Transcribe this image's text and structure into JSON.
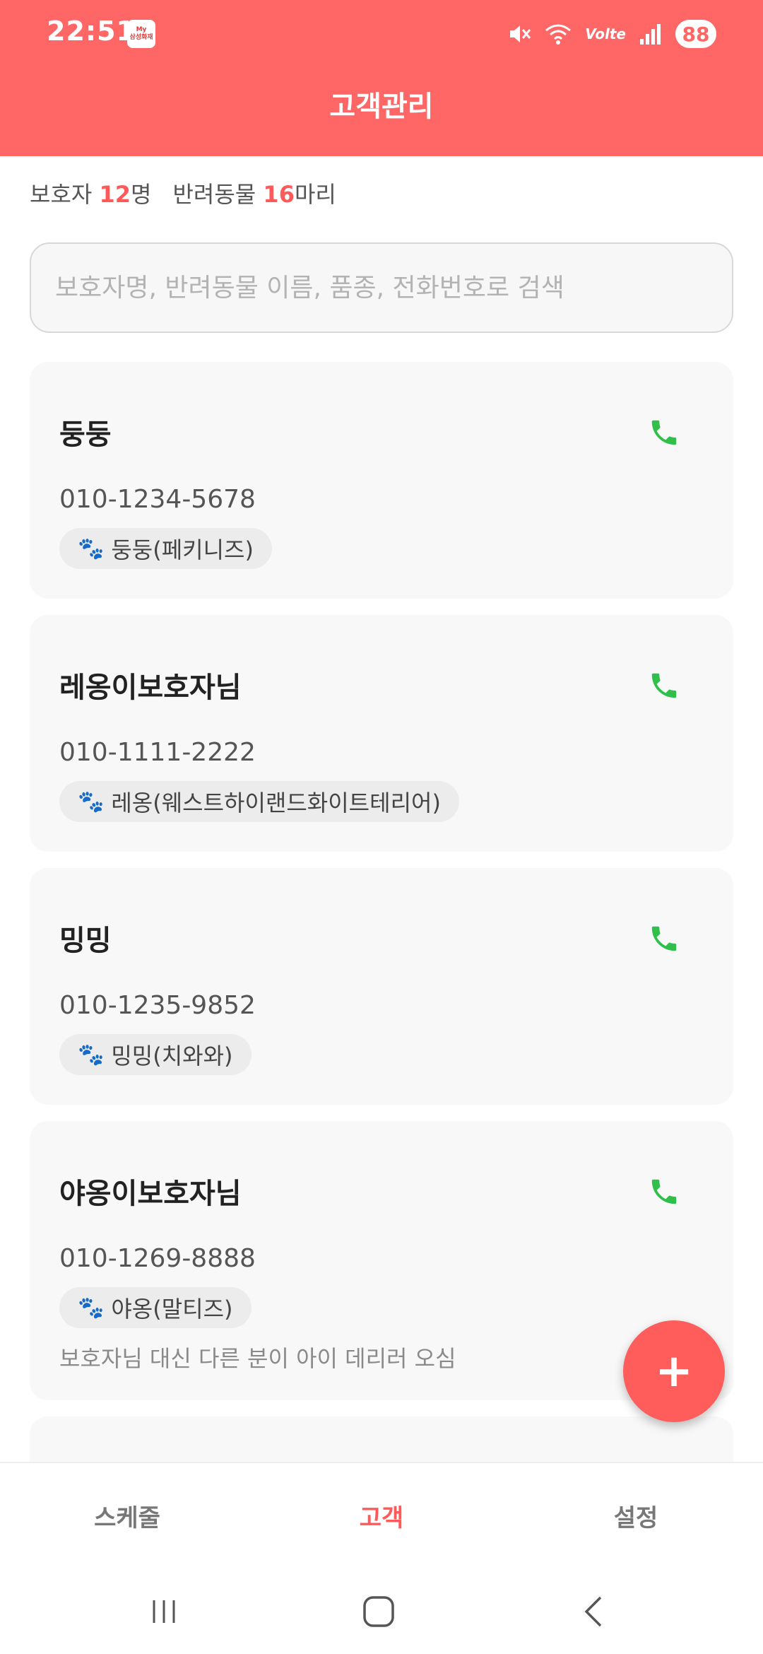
{
  "status_bar": {
    "time": "22:51",
    "app_badge_line1": "My",
    "app_badge_line2": "삼성화재",
    "network": "Volte",
    "battery": "88"
  },
  "header": {
    "title": "고객관리"
  },
  "summary": {
    "guardian_label": "보호자",
    "guardian_count": "12",
    "guardian_unit": "명",
    "pet_label": "반려동물",
    "pet_count": "16",
    "pet_unit": "마리"
  },
  "search": {
    "placeholder": "보호자명, 반려동물 이름, 품종, 전화번호로 검색",
    "value": ""
  },
  "customers": [
    {
      "name": "둥둥",
      "phone": "010-1234-5678",
      "pet": "둥둥(페키니즈)",
      "note": ""
    },
    {
      "name": "레옹이보호자님",
      "phone": "010-1111-2222",
      "pet": "레옹(웨스트하이랜드화이트테리어)",
      "note": ""
    },
    {
      "name": "밍밍",
      "phone": "010-1235-9852",
      "pet": "밍밍(치와와)",
      "note": ""
    },
    {
      "name": "야옹이보호자님",
      "phone": "010-1269-8888",
      "pet": "야옹(말티즈)",
      "note": "보호자님 대신 다른 분이 아이 데리러 오심"
    }
  ],
  "fab": {
    "label": "+"
  },
  "bottom_nav": {
    "items": [
      {
        "label": "스케줄"
      },
      {
        "label": "고객"
      },
      {
        "label": "설정"
      }
    ],
    "active": "고객"
  },
  "colors": {
    "accent": "#ff6666",
    "call_green": "#2fbf4a"
  },
  "icons": {
    "call": "phone-icon",
    "pet": "paw-icon",
    "fab": "plus-icon"
  }
}
